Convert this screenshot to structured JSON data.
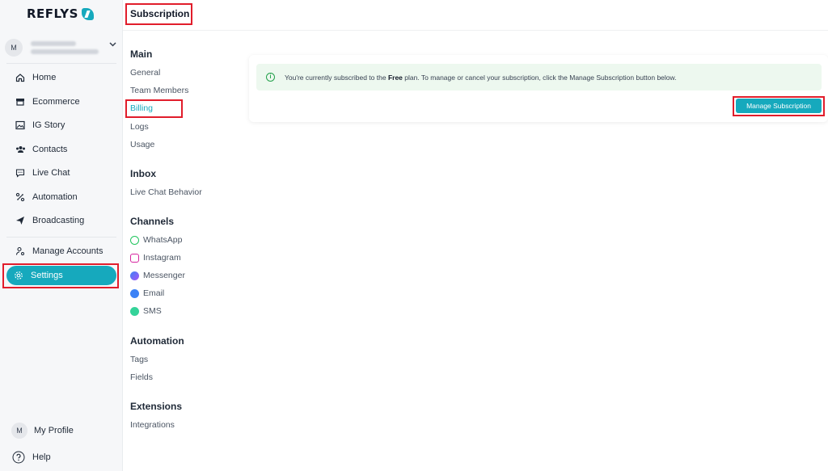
{
  "brand": {
    "name": "REFLYS",
    "accent": "#16a9bd"
  },
  "account": {
    "initial": "M"
  },
  "sidebar": {
    "items": [
      {
        "label": "Home",
        "icon": "home-icon"
      },
      {
        "label": "Ecommerce",
        "icon": "store-icon"
      },
      {
        "label": "IG Story",
        "icon": "image-icon"
      },
      {
        "label": "Contacts",
        "icon": "users-icon"
      },
      {
        "label": "Live Chat",
        "icon": "chat-icon"
      },
      {
        "label": "Automation",
        "icon": "automation-icon"
      },
      {
        "label": "Broadcasting",
        "icon": "send-icon"
      },
      {
        "label": "Manage Accounts",
        "icon": "manage-accounts-icon"
      },
      {
        "label": "Settings",
        "icon": "gear-icon",
        "active": true
      }
    ],
    "bottom": [
      {
        "label": "My Profile",
        "initial": "M"
      },
      {
        "label": "Help",
        "icon": "help-icon"
      }
    ]
  },
  "page": {
    "title": "Subscription"
  },
  "settings_nav": {
    "sections": [
      {
        "title": "Main",
        "items": [
          "General",
          "Team Members",
          "Billing",
          "Logs",
          "Usage"
        ],
        "active": "Billing"
      },
      {
        "title": "Inbox",
        "items": [
          "Live Chat Behavior"
        ]
      },
      {
        "title": "Channels",
        "items": [
          "WhatsApp",
          "Instagram",
          "Messenger",
          "Email",
          "SMS"
        ]
      },
      {
        "title": "Automation",
        "items": [
          "Tags",
          "Fields"
        ]
      },
      {
        "title": "Extensions",
        "items": [
          "Integrations"
        ]
      }
    ]
  },
  "alert": {
    "prefix": "You're currently subscribed to the",
    "plan": "Free",
    "suffix": "plan. To manage or cancel your subscription, click the Manage Subscription button below."
  },
  "manage_button": "Manage Subscription"
}
